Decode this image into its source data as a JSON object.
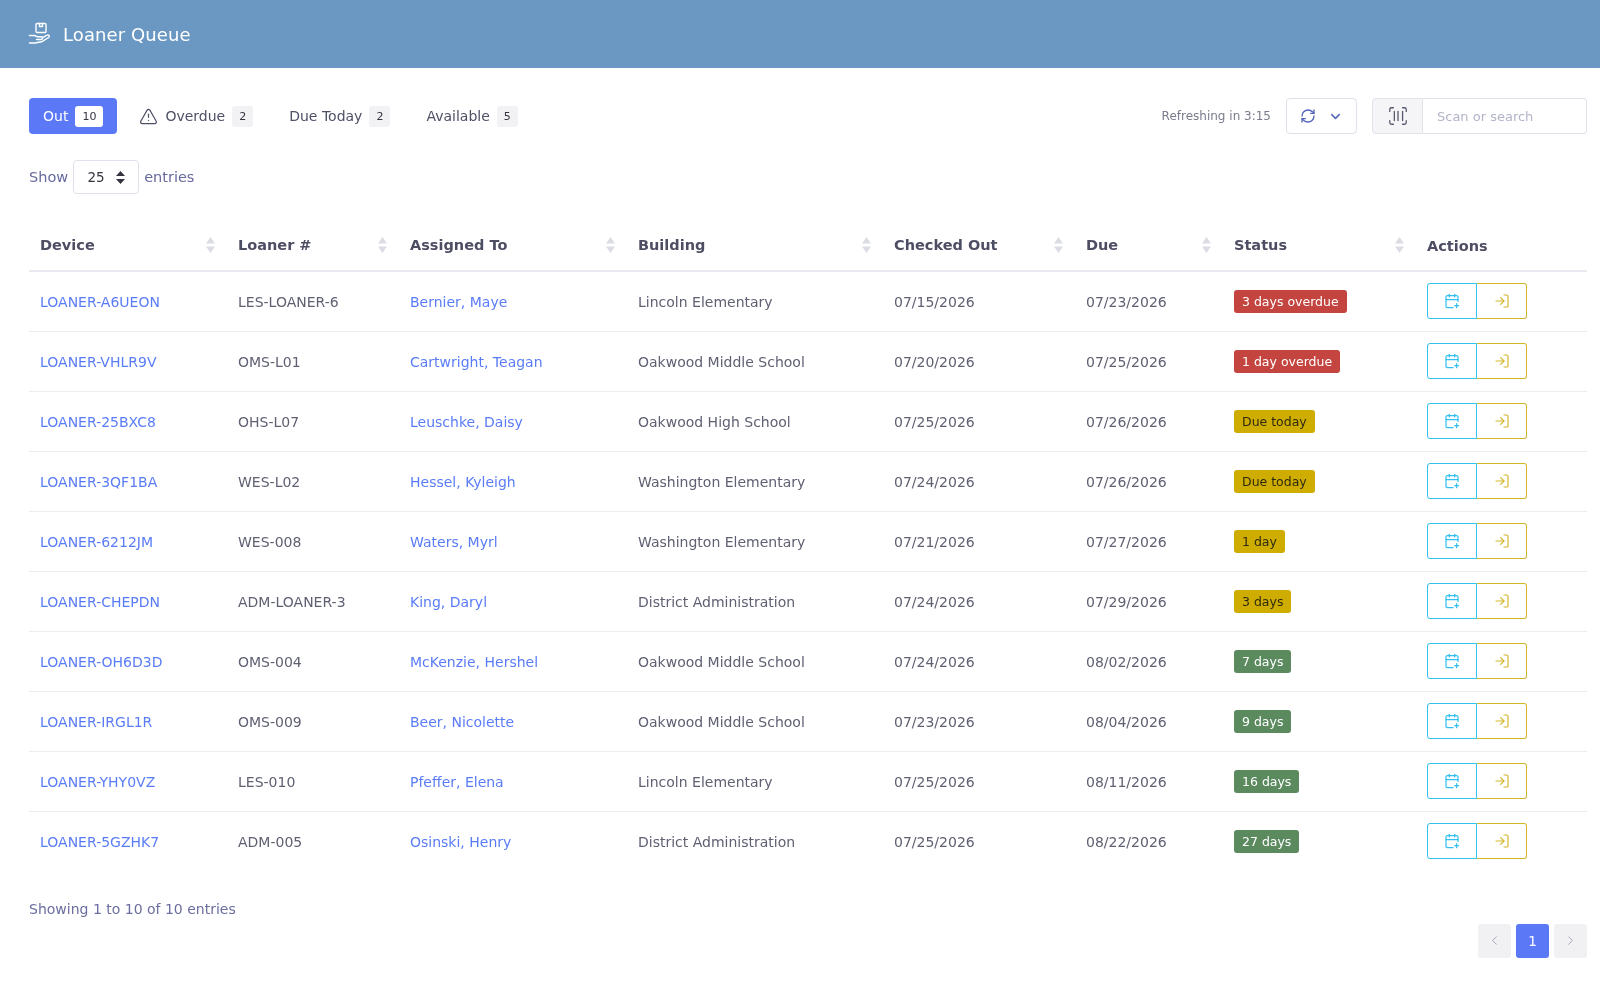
{
  "header": {
    "title": "Loaner Queue"
  },
  "tabs": [
    {
      "label": "Out",
      "count": "10",
      "selected": true,
      "kind": "plain"
    },
    {
      "label": "Overdue",
      "count": "2",
      "selected": false,
      "kind": "alert"
    },
    {
      "label": "Due Today",
      "count": "2",
      "selected": false,
      "kind": "plain"
    },
    {
      "label": "Available",
      "count": "5",
      "selected": false,
      "kind": "plain"
    }
  ],
  "refresh": {
    "text": "Refreshing in 3:15"
  },
  "search": {
    "placeholder": "Scan or search"
  },
  "length_menu": {
    "before": "Show",
    "value": "25",
    "after": "entries"
  },
  "table": {
    "columns": [
      {
        "label": "Device",
        "sortable": true
      },
      {
        "label": "Loaner #",
        "sortable": true
      },
      {
        "label": "Assigned To",
        "sortable": true
      },
      {
        "label": "Building",
        "sortable": true
      },
      {
        "label": "Checked Out",
        "sortable": true
      },
      {
        "label": "Due",
        "sortable": true
      },
      {
        "label": "Status",
        "sortable": true
      },
      {
        "label": "Actions",
        "sortable": false
      }
    ],
    "rows": [
      {
        "device": "LOANER-A6UEON",
        "loaner": "LES-LOANER-6",
        "assigned_to": "Bernier, Maye",
        "building": "Lincoln Elementary",
        "checked_out": "07/15/2026",
        "due": "07/23/2026",
        "status": {
          "text": "3 days overdue",
          "color": "#c4453f"
        }
      },
      {
        "device": "LOANER-VHLR9V",
        "loaner": "OMS-L01",
        "assigned_to": "Cartwright, Teagan",
        "building": "Oakwood Middle School",
        "checked_out": "07/20/2026",
        "due": "07/25/2026",
        "status": {
          "text": "1 day overdue",
          "color": "#c4453f"
        }
      },
      {
        "device": "LOANER-25BXC8",
        "loaner": "OHS-L07",
        "assigned_to": "Leuschke, Daisy",
        "building": "Oakwood High School",
        "checked_out": "07/25/2026",
        "due": "07/26/2026",
        "status": {
          "text": "Due today",
          "color": "#cfad00"
        }
      },
      {
        "device": "LOANER-3QF1BA",
        "loaner": "WES-L02",
        "assigned_to": "Hessel, Kyleigh",
        "building": "Washington Elementary",
        "checked_out": "07/24/2026",
        "due": "07/26/2026",
        "status": {
          "text": "Due today",
          "color": "#cfad00"
        }
      },
      {
        "device": "LOANER-6212JM",
        "loaner": "WES-008",
        "assigned_to": "Waters, Myrl",
        "building": "Washington Elementary",
        "checked_out": "07/21/2026",
        "due": "07/27/2026",
        "status": {
          "text": "1 day",
          "color": "#cfad00"
        }
      },
      {
        "device": "LOANER-CHEPDN",
        "loaner": "ADM-LOANER-3",
        "assigned_to": "King, Daryl",
        "building": "District Administration",
        "checked_out": "07/24/2026",
        "due": "07/29/2026",
        "status": {
          "text": "3 days",
          "color": "#cfad00"
        }
      },
      {
        "device": "LOANER-OH6D3D",
        "loaner": "OMS-004",
        "assigned_to": "McKenzie, Hershel",
        "building": "Oakwood Middle School",
        "checked_out": "07/24/2026",
        "due": "08/02/2026",
        "status": {
          "text": "7 days",
          "color": "#5b8a5f"
        }
      },
      {
        "device": "LOANER-IRGL1R",
        "loaner": "OMS-009",
        "assigned_to": "Beer, Nicolette",
        "building": "Oakwood Middle School",
        "checked_out": "07/23/2026",
        "due": "08/04/2026",
        "status": {
          "text": "9 days",
          "color": "#5b8a5f"
        }
      },
      {
        "device": "LOANER-YHY0VZ",
        "loaner": "LES-010",
        "assigned_to": "Pfeffer, Elena",
        "building": "Lincoln Elementary",
        "checked_out": "07/25/2026",
        "due": "08/11/2026",
        "status": {
          "text": "16 days",
          "color": "#5b8a5f"
        }
      },
      {
        "device": "LOANER-5GZHK7",
        "loaner": "ADM-005",
        "assigned_to": "Osinski, Henry",
        "building": "District Administration",
        "checked_out": "07/25/2026",
        "due": "08/22/2026",
        "status": {
          "text": "27 days",
          "color": "#5b8a5f"
        }
      }
    ]
  },
  "footer": {
    "info": "Showing 1 to 10 of 10 entries"
  },
  "pagination": {
    "previous": {
      "disabled": true
    },
    "pages": [
      {
        "label": "1",
        "selected": true
      }
    ],
    "next": {
      "disabled": true
    }
  }
}
